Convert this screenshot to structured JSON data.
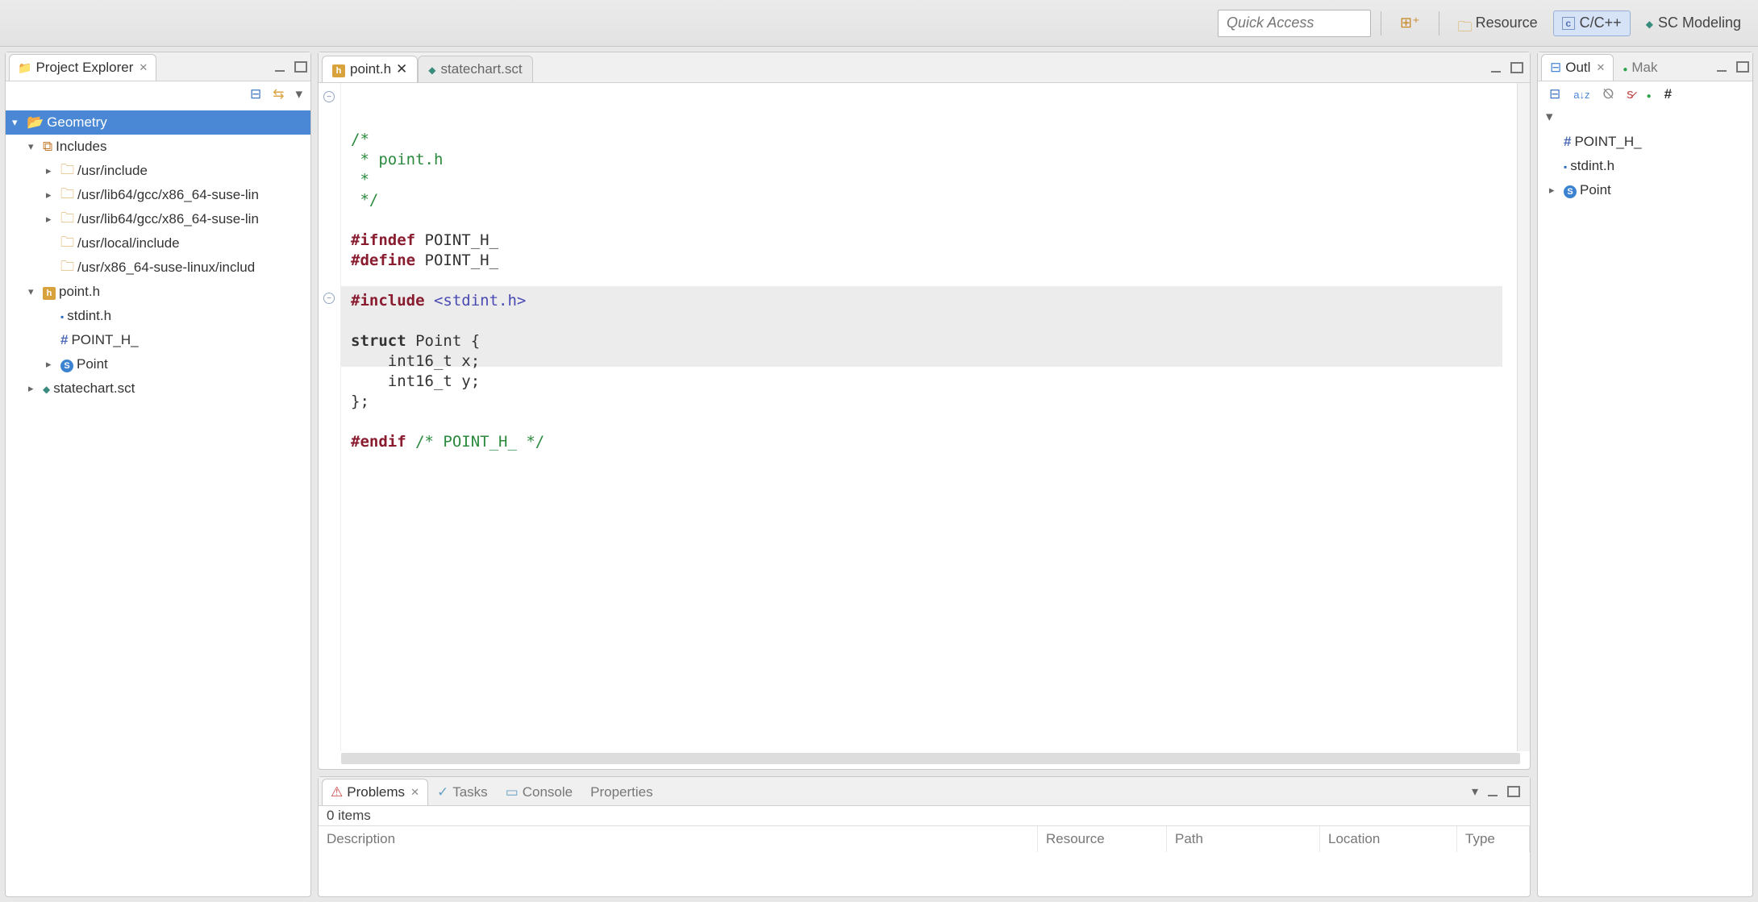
{
  "toolbar": {
    "quick_access_placeholder": "Quick Access",
    "perspectives": {
      "resource": "Resource",
      "cpp": "C/C++",
      "sc_modeling": "SC Modeling"
    }
  },
  "left": {
    "view_title": "Project Explorer",
    "tree": {
      "project": "Geometry",
      "includes_label": "Includes",
      "includes": [
        "/usr/include",
        "/usr/lib64/gcc/x86_64-suse-lin",
        "/usr/lib64/gcc/x86_64-suse-lin",
        "/usr/local/include",
        "/usr/x86_64-suse-linux/includ"
      ],
      "file1": "point.h",
      "file1_children": {
        "stdint": "stdint.h",
        "macro": "POINT_H_",
        "struct": "Point"
      },
      "file2": "statechart.sct"
    }
  },
  "editor": {
    "tab1": "point.h",
    "tab2": "statechart.sct",
    "lines": {
      "c1": "/*",
      "c2": " * point.h",
      "c3": " *",
      "c4": " */",
      "ifndef_kw": "#ifndef",
      "ifndef_val": " POINT_H_",
      "define_kw": "#define",
      "define_val": " POINT_H_",
      "include_kw": "#include",
      "include_val": " <stdint.h>",
      "struct_kw": "struct",
      "struct_line": " Point {",
      "field1": "    int16_t x;",
      "field2": "    int16_t y;",
      "close": "};",
      "endif_kw": "#endif",
      "endif_cmt": " /* POINT_H_ */"
    }
  },
  "right": {
    "view_title": "Outl",
    "view_title2": "Mak",
    "items": {
      "macro": "POINT_H_",
      "stdint": "stdint.h",
      "point": "Point"
    }
  },
  "bottom": {
    "tabs": {
      "problems": "Problems",
      "tasks": "Tasks",
      "console": "Console",
      "properties": "Properties"
    },
    "count_text": "0 items",
    "columns": {
      "description": "Description",
      "resource": "Resource",
      "path": "Path",
      "location": "Location",
      "type": "Type"
    }
  }
}
